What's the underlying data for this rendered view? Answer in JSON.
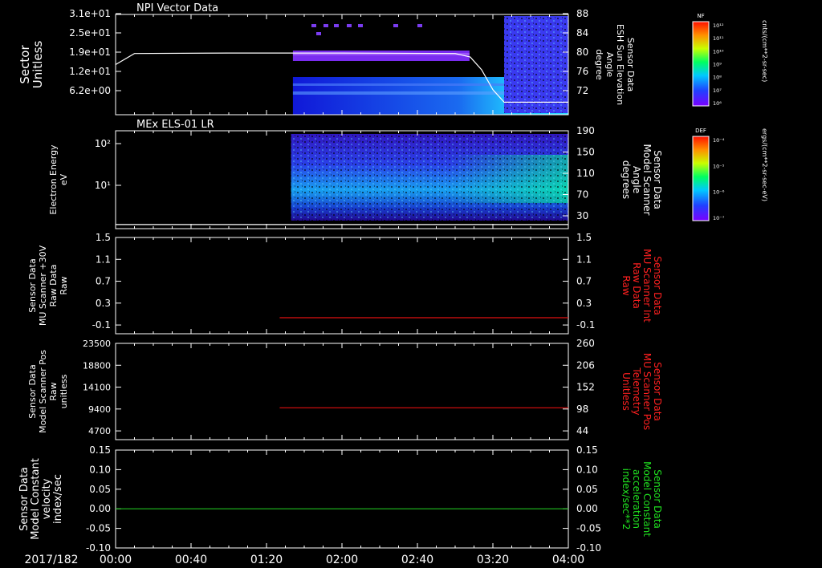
{
  "chart_data": [
    {
      "type": "heatmap",
      "title": "NPI Vector Data",
      "ylabel": [
        "Sector",
        "Unitless"
      ],
      "yticks": [
        "3.1e+01",
        "2.5e+01",
        "1.9e+01",
        "1.2e+01",
        "6.2e+00"
      ],
      "ylim": [
        0,
        31
      ],
      "y2label": [
        "Sensor Data",
        "ESH Sun Elevation",
        "Angle",
        "degree"
      ],
      "y2ticks": [
        "88",
        "84",
        "80",
        "76",
        "72"
      ],
      "y2lim": [
        68,
        88
      ],
      "colorbar": {
        "title": "NF",
        "units": "cnts/(cm**2-sr-sec)",
        "ticks": [
          "10¹²",
          "10¹¹",
          "10¹⁰",
          "10⁹",
          "10⁸",
          "10⁷",
          "10⁶"
        ]
      },
      "data_start_time": "01:34",
      "series": [
        {
          "points": [
            [
              "00:00",
              78
            ],
            [
              "00:10",
              80.2
            ],
            [
              "01:00",
              80.3
            ],
            [
              "02:00",
              80.3
            ],
            [
              "03:00",
              80.2
            ],
            [
              "03:08",
              79.5
            ],
            [
              "03:14",
              77
            ],
            [
              "03:20",
              73
            ],
            [
              "03:26",
              70.5
            ],
            [
              "03:35",
              70.5
            ],
            [
              "04:00",
              70.5
            ]
          ]
        }
      ]
    },
    {
      "type": "heatmap",
      "title": "MEx ELS-01 LR",
      "ylabel": [
        "Electron Energy",
        "eV"
      ],
      "yticks": [
        "10²",
        "10¹"
      ],
      "ylim": [
        1,
        200
      ],
      "y2label": [
        "Sensor Data",
        "Model Scanner",
        "Angle",
        "degrees"
      ],
      "y2ticks": [
        "190",
        "150",
        "110",
        "70",
        "30"
      ],
      "y2lim": [
        0,
        190
      ],
      "colorbar": {
        "title": "DEF",
        "units": "ergs/(cm**2-sr-sec-eV)",
        "ticks": [
          "10⁻⁴",
          "10⁻⁵",
          "10⁻⁶",
          "10⁻⁷"
        ]
      },
      "data_start_time": "01:33",
      "series": [
        {
          "points": [
            [
              "00:00",
              8
            ],
            [
              "04:00",
              8
            ]
          ]
        }
      ]
    },
    {
      "type": "line",
      "ylabel": [
        "Sensor Data",
        "MU Scanner +30V",
        "Raw Data",
        "Raw"
      ],
      "yticks": [
        "1.5",
        "1.1",
        "0.7",
        "0.3",
        "-0.1"
      ],
      "ylim": [
        -0.3,
        1.5
      ],
      "y2label": [
        "Sensor Data",
        "MU Scanner Int",
        "Raw Data",
        "Raw"
      ],
      "y2ticks": [
        "1.5",
        "1.1",
        "0.7",
        "0.3",
        "-0.1"
      ],
      "y2lim": [
        -0.3,
        1.5
      ],
      "series": [
        {
          "axis": "right",
          "color": "#e01010",
          "points": [
            [
              "01:27",
              0.0
            ],
            [
              "04:00",
              0.0
            ]
          ]
        }
      ]
    },
    {
      "type": "line",
      "ylabel": [
        "Sensor Data",
        "Model Scanner Pos",
        "Raw",
        "unitless"
      ],
      "yticks": [
        "23500",
        "18800",
        "14100",
        "9400",
        "4700"
      ],
      "ylim": [
        0,
        23500
      ],
      "y2label": [
        "Sensor Data",
        "MU Scanner Pos",
        "Telemetry",
        "Unitless"
      ],
      "y2ticks": [
        "260",
        "206",
        "152",
        "98",
        "44"
      ],
      "y2lim": [
        0,
        260
      ],
      "series": [
        {
          "axis": "right",
          "color": "#e01010",
          "points": [
            [
              "01:27",
              86
            ],
            [
              "04:00",
              86
            ]
          ]
        }
      ]
    },
    {
      "type": "line",
      "ylabel": [
        "Sensor Data",
        "Model Constant",
        "velocity",
        "index/sec"
      ],
      "yticks": [
        "0.15",
        "0.10",
        "0.05",
        "0.00",
        "-0.05",
        "-0.10"
      ],
      "ylim": [
        -0.1,
        0.15
      ],
      "y2label": [
        "Sensor Data",
        "Model Constant",
        "acceleration",
        "index/sec**2"
      ],
      "y2ticks": [
        "0.15",
        "0.10",
        "0.05",
        "0.00",
        "-0.05",
        "-0.10"
      ],
      "y2lim": [
        -0.1,
        0.15
      ],
      "series": [
        {
          "axis": "left",
          "color": "#20c020",
          "points": [
            [
              "00:00",
              0.0
            ],
            [
              "04:00",
              0.0
            ]
          ]
        }
      ]
    }
  ],
  "xaxis": {
    "date": "2017/182",
    "ticks": [
      "00:00",
      "00:40",
      "01:20",
      "02:00",
      "02:40",
      "03:20",
      "04:00"
    ],
    "range": [
      "00:00",
      "04:00"
    ]
  },
  "colors": {
    "axis": "#ffffff",
    "red_label": "#ff2020",
    "green_label": "#20e020"
  }
}
